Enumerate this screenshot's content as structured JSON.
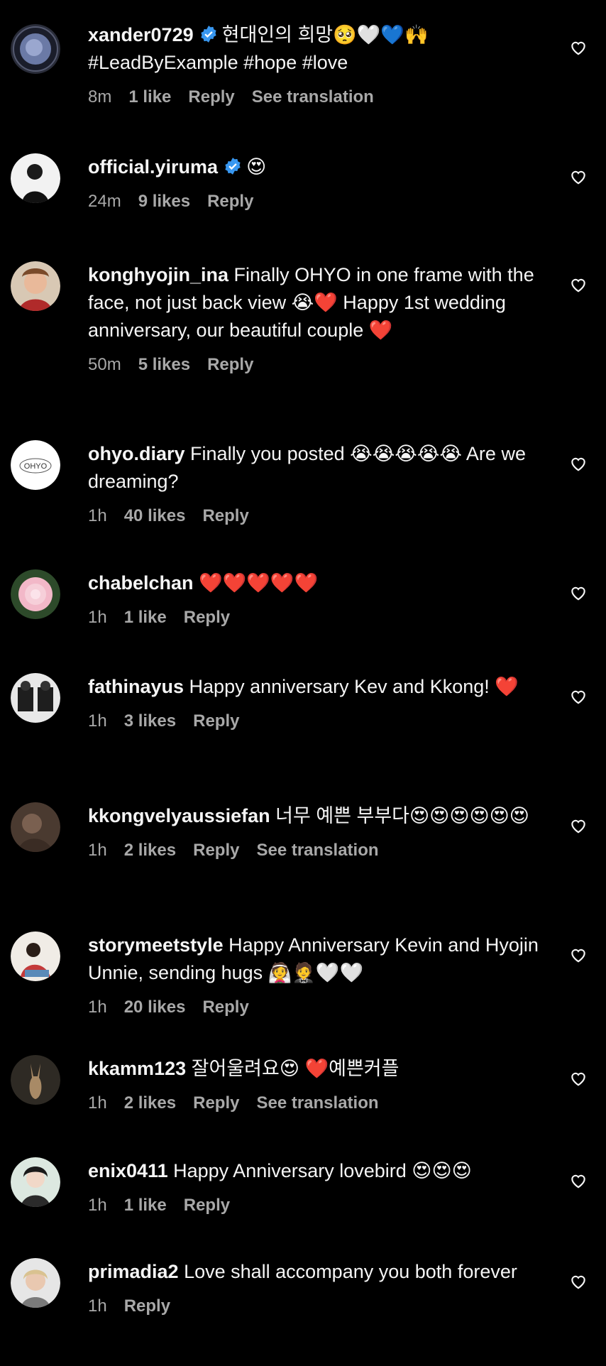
{
  "comments": [
    {
      "username": "xander0729",
      "verified": true,
      "text": "현대인의 희망🥺🤍💙🙌 #LeadByExample #hope #love",
      "time": "8m",
      "likes": "1 like",
      "reply": "Reply",
      "translate": "See translation"
    },
    {
      "username": "official.yiruma",
      "verified": true,
      "text": "😍",
      "time": "24m",
      "likes": "9 likes",
      "reply": "Reply",
      "translate": ""
    },
    {
      "username": "konghyojin_ina",
      "verified": false,
      "text": "Finally OHYO in one frame with the face, not just back view 😭❤️ Happy 1st wedding anniversary, our beautiful couple ❤️",
      "time": "50m",
      "likes": "5 likes",
      "reply": "Reply",
      "translate": ""
    },
    {
      "username": "ohyo.diary",
      "verified": false,
      "text": "Finally you posted 😭😭😭😭😭 Are we dreaming?",
      "time": "1h",
      "likes": "40 likes",
      "reply": "Reply",
      "translate": ""
    },
    {
      "username": "chabelchan",
      "verified": false,
      "text": "❤️❤️❤️❤️❤️",
      "time": "1h",
      "likes": "1 like",
      "reply": "Reply",
      "translate": ""
    },
    {
      "username": "fathinayus",
      "verified": false,
      "text": "Happy anniversary Kev and Kkong! ❤️",
      "time": "1h",
      "likes": "3 likes",
      "reply": "Reply",
      "translate": ""
    },
    {
      "username": "kkongvelyaussiefan",
      "verified": false,
      "text": "너무 예쁜 부부다😍😍😍😍😍😍",
      "time": "1h",
      "likes": "2 likes",
      "reply": "Reply",
      "translate": "See translation"
    },
    {
      "username": "storymeetstyle",
      "verified": false,
      "text": "Happy Anniversary Kevin and Hyojin Unnie, sending hugs 👰🤵🤍🤍",
      "time": "1h",
      "likes": "20 likes",
      "reply": "Reply",
      "translate": ""
    },
    {
      "username": "kkamm123",
      "verified": false,
      "text": "잘어울려요😍 ❤️예쁜커플",
      "time": "1h",
      "likes": "2 likes",
      "reply": "Reply",
      "translate": "See translation"
    },
    {
      "username": "enix0411",
      "verified": false,
      "text": "Happy Anniversary lovebird 😍😍😍",
      "time": "1h",
      "likes": "1 like",
      "reply": "Reply",
      "translate": ""
    },
    {
      "username": "primadia2",
      "verified": false,
      "text": "Love shall accompany you both forever",
      "time": "1h",
      "likes": "",
      "reply": "Reply",
      "translate": ""
    }
  ],
  "colors": {
    "background": "#000000",
    "text": "#f5f5f5",
    "meta": "#a8a8a8",
    "verified": "#3897f0"
  },
  "icons": {
    "verified": "verified-badge-icon",
    "like": "heart-outline-icon"
  }
}
